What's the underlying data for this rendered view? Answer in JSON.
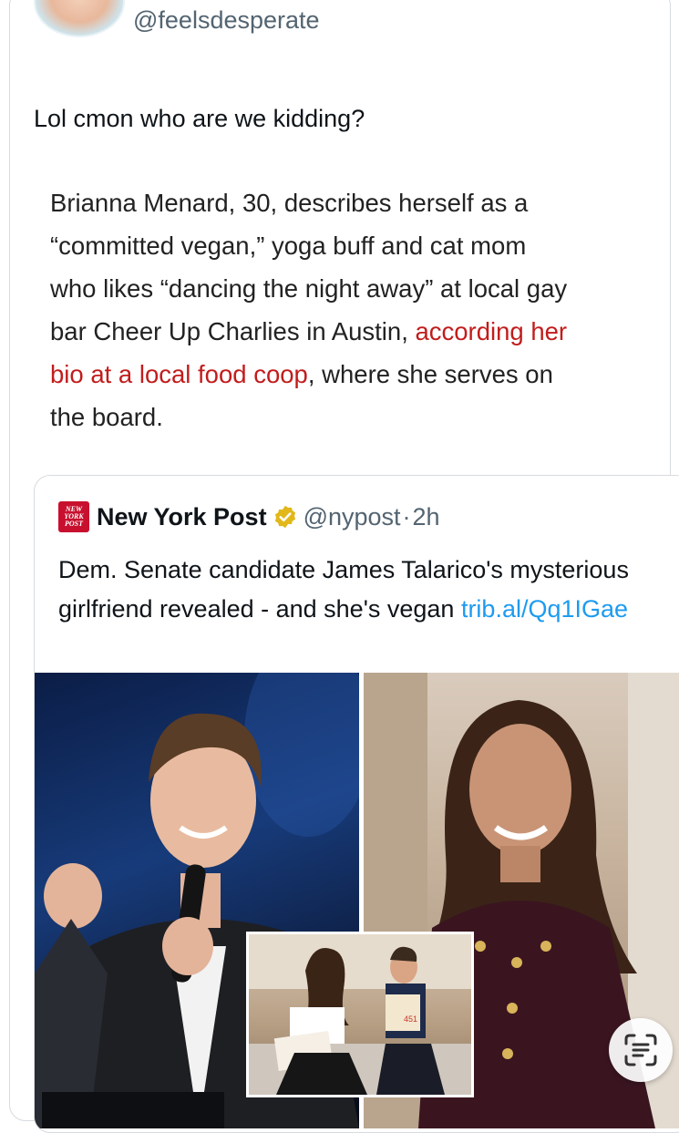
{
  "tweet": {
    "handle": "@feelsdesperate",
    "text": "Lol cmon who are we kidding?"
  },
  "screenshot_text": {
    "lines": [
      {
        "parts": [
          {
            "text": "Brianna Menard, 30, describes herself as a",
            "red": false
          }
        ]
      },
      {
        "parts": [
          {
            "text": "“committed vegan,” yoga buff and cat mom",
            "red": false
          }
        ]
      },
      {
        "parts": [
          {
            "text": "who likes “dancing the night away” at local gay",
            "red": false
          }
        ]
      },
      {
        "parts": [
          {
            "text": "bar Cheer Up Charlies in Austin, ",
            "red": false
          },
          {
            "text": "according her",
            "red": true
          }
        ]
      },
      {
        "parts": [
          {
            "text": "bio at a local food coop",
            "red": true
          },
          {
            "text": ", where she serves on",
            "red": false
          }
        ]
      },
      {
        "parts": [
          {
            "text": "the board.",
            "red": false
          }
        ]
      }
    ],
    "link_color": "#c21c1c"
  },
  "quoted_tweet": {
    "logo_text": [
      "NEW",
      "YORK",
      "POST"
    ],
    "name": "New York Post",
    "handle": "@nypost",
    "separator": "·",
    "time": "2h",
    "text": "Dem. Senate candidate James Talarico's mysterious girlfriend revealed - and she's vegan",
    "link": "trib.al/Qq1IGae",
    "verified_color": "#e2b719",
    "inset_book_text": "451"
  },
  "icons": {
    "lens": "scan-text-icon",
    "verified": "verified-badge-icon"
  }
}
